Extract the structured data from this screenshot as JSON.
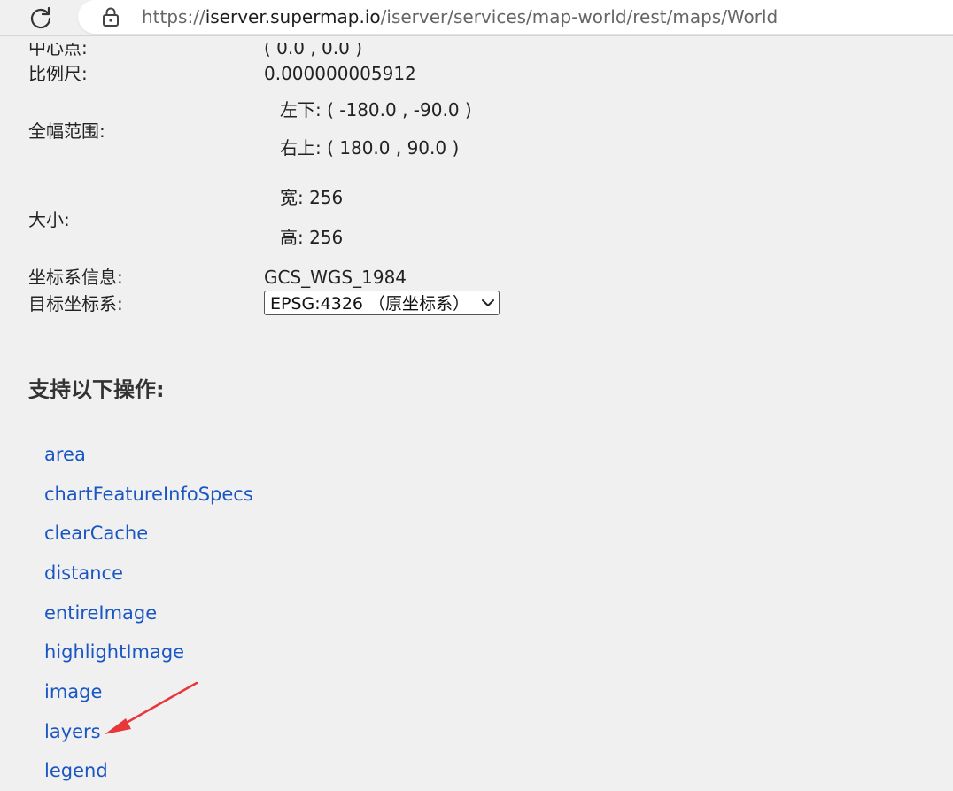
{
  "browser": {
    "url_prefix": "https://",
    "url_host": "iserver.supermap.io",
    "url_path": "/iserver/services/map-world/rest/maps/World"
  },
  "map_info": {
    "center_label": "中心点:",
    "center_value": "( 0.0 , 0.0 )",
    "scale_label": "比例尺:",
    "scale_value": "0.000000005912",
    "bounds_label": "全幅范围:",
    "bounds_lower_left": "左下: ( -180.0 , -90.0 )",
    "bounds_upper_right": "右上: ( 180.0 , 90.0 )",
    "size_label": "大小:",
    "size_width": "宽: 256",
    "size_height": "高: 256",
    "crs_label": "坐标系信息:",
    "crs_value": "GCS_WGS_1984",
    "target_crs_label": "目标坐标系:",
    "target_crs_selected": "EPSG:4326 （原坐标系）"
  },
  "operations": {
    "title": "支持以下操作:",
    "items": [
      "area",
      "chartFeatureInfoSpecs",
      "clearCache",
      "distance",
      "entireImage",
      "highlightImage",
      "image",
      "layers",
      "legend"
    ]
  },
  "colors": {
    "link": "#1a56c4",
    "annotation_arrow": "#e8373a"
  },
  "icons": {
    "reload": "reload-icon",
    "lock": "lock-icon",
    "select_chevron": "chevron-down-icon",
    "annotation": "red-arrow-annotation"
  }
}
